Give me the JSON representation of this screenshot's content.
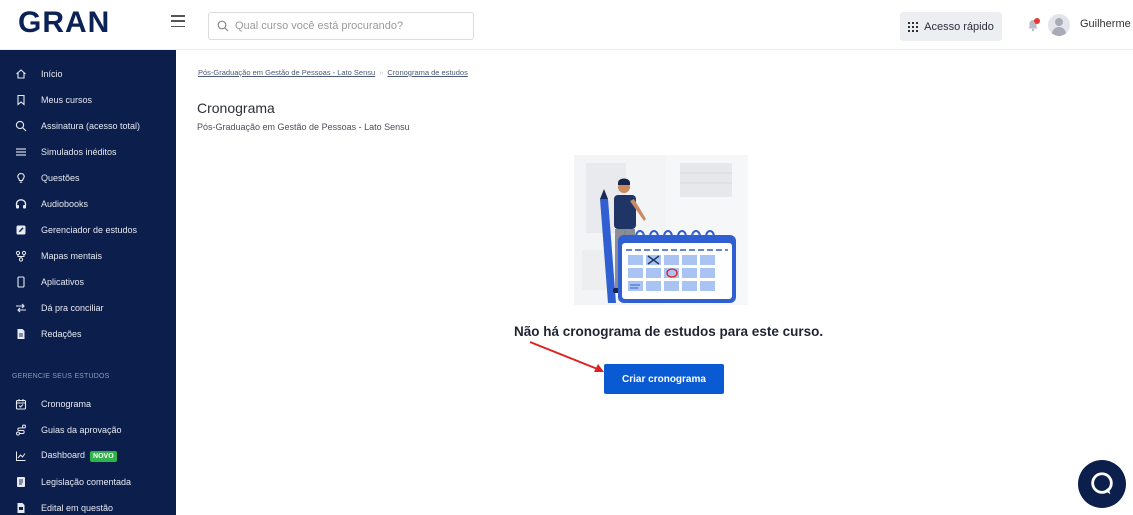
{
  "brand": {
    "logo_text": "GRAN"
  },
  "search": {
    "placeholder": "Qual curso você está procurando?"
  },
  "header": {
    "quick_access_label": "Acesso rápido",
    "user_name": "Guilherme"
  },
  "sidebar": {
    "items": [
      {
        "label": "Início",
        "icon": "home-icon"
      },
      {
        "label": "Meus cursos",
        "icon": "bookmark-icon"
      },
      {
        "label": "Assinatura (acesso total)",
        "icon": "search-icon"
      },
      {
        "label": "Simulados inéditos",
        "icon": "list-icon"
      },
      {
        "label": "Questões",
        "icon": "lightbulb-icon"
      },
      {
        "label": "Audiobooks",
        "icon": "headphones-icon"
      },
      {
        "label": "Gerenciador de estudos",
        "icon": "edit-icon"
      },
      {
        "label": "Mapas mentais",
        "icon": "mindmap-icon"
      },
      {
        "label": "Aplicativos",
        "icon": "phone-icon"
      },
      {
        "label": "Dá pra conciliar",
        "icon": "swap-icon"
      },
      {
        "label": "Redações",
        "icon": "document-icon"
      }
    ],
    "section_title": "GERENCIE SEUS ESTUDOS",
    "study_items": [
      {
        "label": "Cronograma",
        "icon": "calendar-icon"
      },
      {
        "label": "Guias da aprovação",
        "icon": "route-icon"
      },
      {
        "label": "Dashboard",
        "icon": "chart-line-icon",
        "badge": "NOVO"
      },
      {
        "label": "Legislação comentada",
        "icon": "book-icon"
      },
      {
        "label": "Edital em questão",
        "icon": "file-icon"
      }
    ]
  },
  "breadcrumb": {
    "course": "Pós-Graduação em Gestão de Pessoas - Lato Sensu",
    "separator": "»",
    "current": "Cronograma de estudos"
  },
  "page": {
    "title": "Cronograma",
    "subtitle": "Pós-Graduação em Gestão de Pessoas - Lato Sensu",
    "empty_message": "Não há cronograma de estudos para este curso.",
    "cta_label": "Criar cronograma"
  },
  "colors": {
    "sidebar_bg": "#0b1e4c",
    "primary": "#0a5ad4",
    "badge_green": "#2fb34a",
    "annotation_red": "#e02020"
  }
}
